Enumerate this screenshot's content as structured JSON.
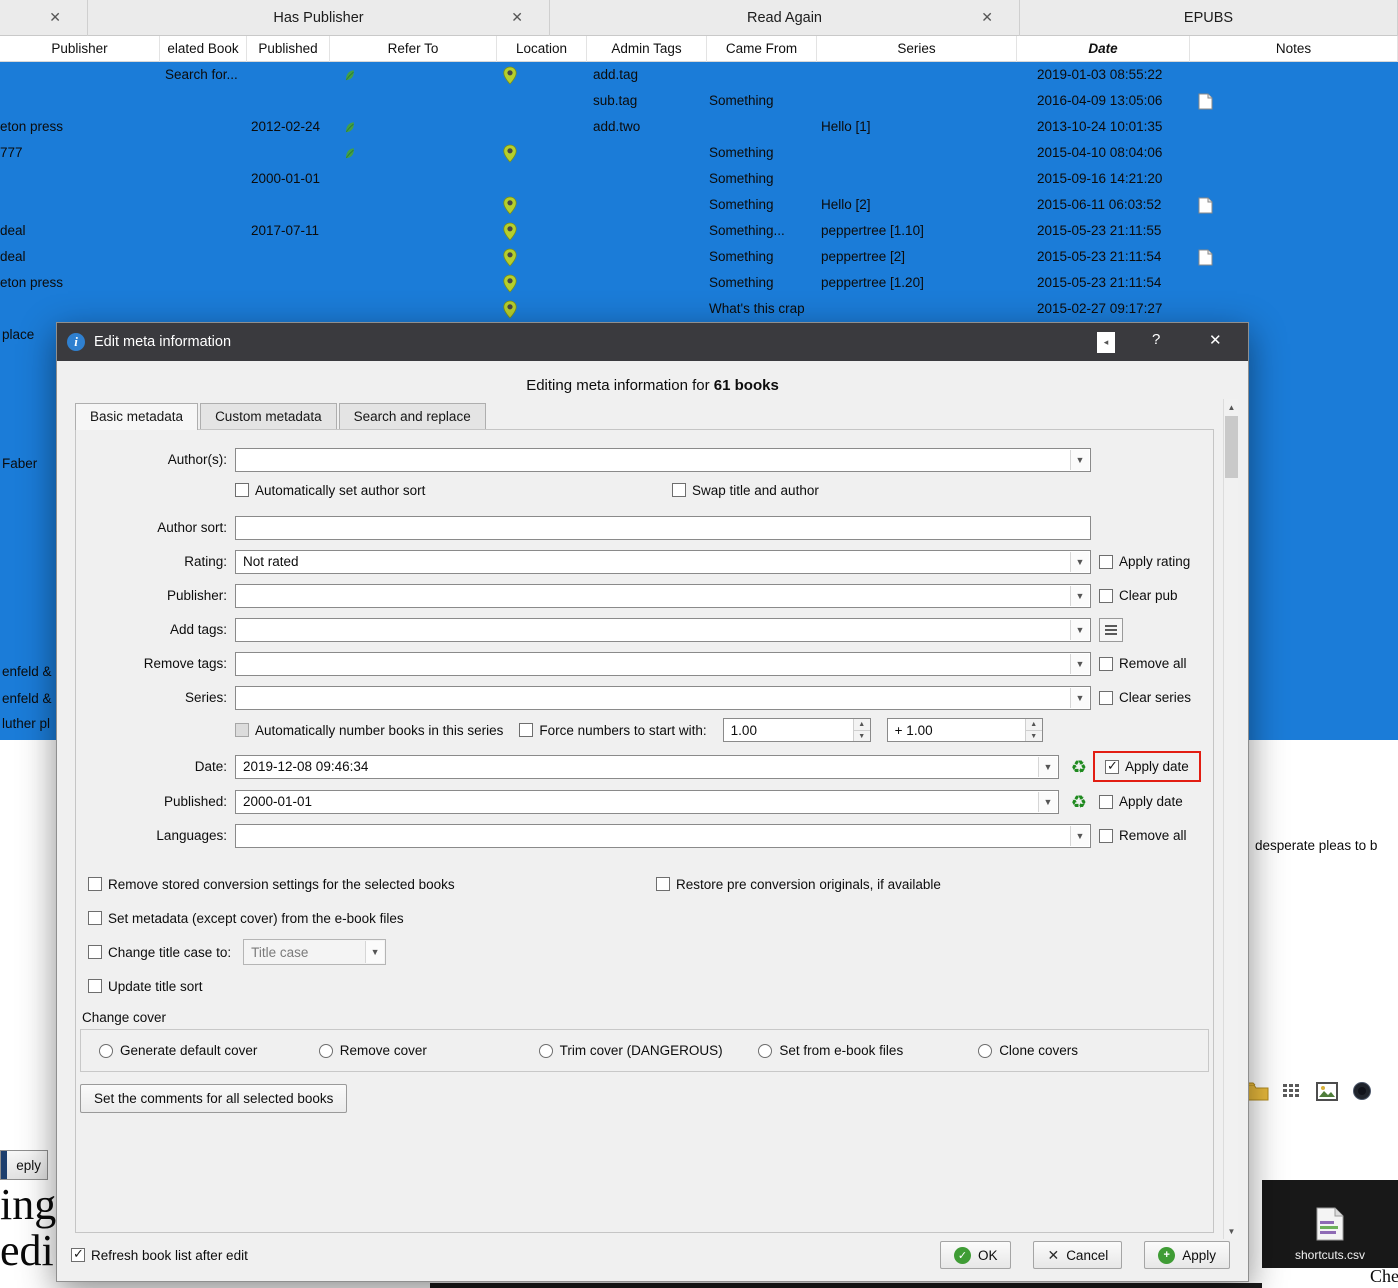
{
  "panel_headers": [
    {
      "label": "",
      "close": "✕"
    },
    {
      "label": "Has Publisher",
      "close": "✕"
    },
    {
      "label": "Read Again",
      "close": "✕"
    },
    {
      "label": "EPUBS",
      "close": ""
    }
  ],
  "table": {
    "columns": [
      "Publisher",
      "elated Book",
      "Published",
      "Refer To",
      "Location",
      "Admin Tags",
      "Came From",
      "Series",
      "Date",
      "Notes"
    ],
    "rows": [
      {
        "publisher": "",
        "related": "Search for...",
        "published": "",
        "leaf": true,
        "pin": true,
        "admin_tags": "add.tag",
        "came_from": "",
        "series": "",
        "date": "2019-01-03 08:55:22",
        "note": false
      },
      {
        "publisher": "",
        "related": "",
        "published": "",
        "leaf": false,
        "pin": false,
        "admin_tags": "sub.tag",
        "came_from": "Something",
        "series": "",
        "date": "2016-04-09 13:05:06",
        "note": true
      },
      {
        "publisher": "eton press",
        "related": "",
        "published": "2012-02-24",
        "leaf": true,
        "pin": false,
        "admin_tags": "add.two",
        "came_from": "",
        "series": "Hello [1]",
        "date": "2013-10-24 10:01:35",
        "note": false
      },
      {
        "publisher": "777",
        "related": "",
        "published": "",
        "leaf": true,
        "pin": true,
        "admin_tags": "",
        "came_from": "Something",
        "series": "",
        "date": "2015-04-10 08:04:06",
        "note": false
      },
      {
        "publisher": "",
        "related": "",
        "published": "2000-01-01",
        "leaf": false,
        "pin": false,
        "admin_tags": "",
        "came_from": "Something",
        "series": "",
        "date": "2015-09-16 14:21:20",
        "note": false
      },
      {
        "publisher": "",
        "related": "",
        "published": "",
        "leaf": false,
        "pin": true,
        "admin_tags": "",
        "came_from": "Something",
        "series": "Hello [2]",
        "date": "2015-06-11 06:03:52",
        "note": true
      },
      {
        "publisher": "deal",
        "related": "",
        "published": "2017-07-11",
        "leaf": false,
        "pin": true,
        "admin_tags": "",
        "came_from": "Something...",
        "series": "peppertree [1.10]",
        "date": "2015-05-23 21:11:55",
        "note": false
      },
      {
        "publisher": "deal",
        "related": "",
        "published": "",
        "leaf": false,
        "pin": true,
        "admin_tags": "",
        "came_from": "Something",
        "series": "peppertree [2]",
        "date": "2015-05-23 21:11:54",
        "note": true
      },
      {
        "publisher": "eton press",
        "related": "",
        "published": "",
        "leaf": false,
        "pin": true,
        "admin_tags": "",
        "came_from": "Something",
        "series": "peppertree [1.20]",
        "date": "2015-05-23 21:11:54",
        "note": false
      },
      {
        "publisher": "",
        "related": "",
        "published": "",
        "leaf": false,
        "pin": true,
        "admin_tags": "",
        "came_from": "What's this crap",
        "series": "",
        "date": "2015-02-27 09:17:27",
        "note": false
      }
    ]
  },
  "left_strip": [
    "place",
    "Faber",
    "enfeld &",
    "enfeld &",
    "luther pl"
  ],
  "right_snippet": "desperate pleas to b",
  "reply_button": "eply",
  "cover_fragments": [
    "ing",
    "edi"
  ],
  "desktop": {
    "file_label": "shortcuts.csv",
    "corner_text": "Che"
  },
  "dialog": {
    "title": "Edit meta information",
    "artifact": "◂",
    "help": "?",
    "close": "✕",
    "header_prefix": "Editing meta information for ",
    "header_count": "61 books",
    "tabs": [
      "Basic metadata",
      "Custom metadata",
      "Search and replace"
    ],
    "fields": {
      "authors_label": "Author(s):",
      "auto_author_sort": "Automatically set author sort",
      "swap_title_author": "Swap title and author",
      "author_sort_label": "Author sort:",
      "rating_label": "Rating:",
      "rating_value": "Not rated",
      "apply_rating": "Apply rating",
      "publisher_label": "Publisher:",
      "clear_pub": "Clear pub",
      "add_tags_label": "Add tags:",
      "remove_tags_label": "Remove tags:",
      "remove_all_tags": "Remove all",
      "series_label": "Series:",
      "clear_series": "Clear series",
      "auto_number": "Automatically number books in this series",
      "force_numbers": "Force numbers to start with:",
      "series_start": "1.00",
      "series_increment": "+ 1.00",
      "date_label": "Date:",
      "date_value": "2019-12-08 09:46:34",
      "apply_date": "Apply date",
      "published_label": "Published:",
      "published_value": "2000-01-01",
      "apply_published": "Apply date",
      "languages_label": "Languages:",
      "remove_all_languages": "Remove all",
      "remove_conversion": "Remove stored conversion settings for the selected books",
      "restore_originals": "Restore pre conversion originals, if available",
      "set_metadata": "Set metadata (except cover) from the e-book files",
      "change_title_case": "Change title case to:",
      "title_case_value": "Title case",
      "update_title_sort": "Update title sort",
      "change_cover": "Change cover",
      "cover_options": [
        "Generate default cover",
        "Remove cover",
        "Trim cover (DANGEROUS)",
        "Set from e-book files",
        "Clone covers"
      ],
      "set_comments": "Set the comments for all selected books"
    },
    "state": {
      "auto_author_sort": false,
      "swap_title_author": false,
      "apply_rating": false,
      "clear_pub": false,
      "remove_all_tags": false,
      "clear_series": false,
      "auto_number": false,
      "force_numbers": false,
      "apply_date": true,
      "apply_published": false,
      "remove_all_languages": false,
      "remove_conversion": false,
      "restore_originals": false,
      "set_metadata": false,
      "change_title_case": false,
      "update_title_sort": false,
      "refresh": true
    },
    "footer": {
      "refresh": "Refresh book list after edit",
      "ok": "OK",
      "cancel": "Cancel",
      "apply": "Apply"
    }
  }
}
